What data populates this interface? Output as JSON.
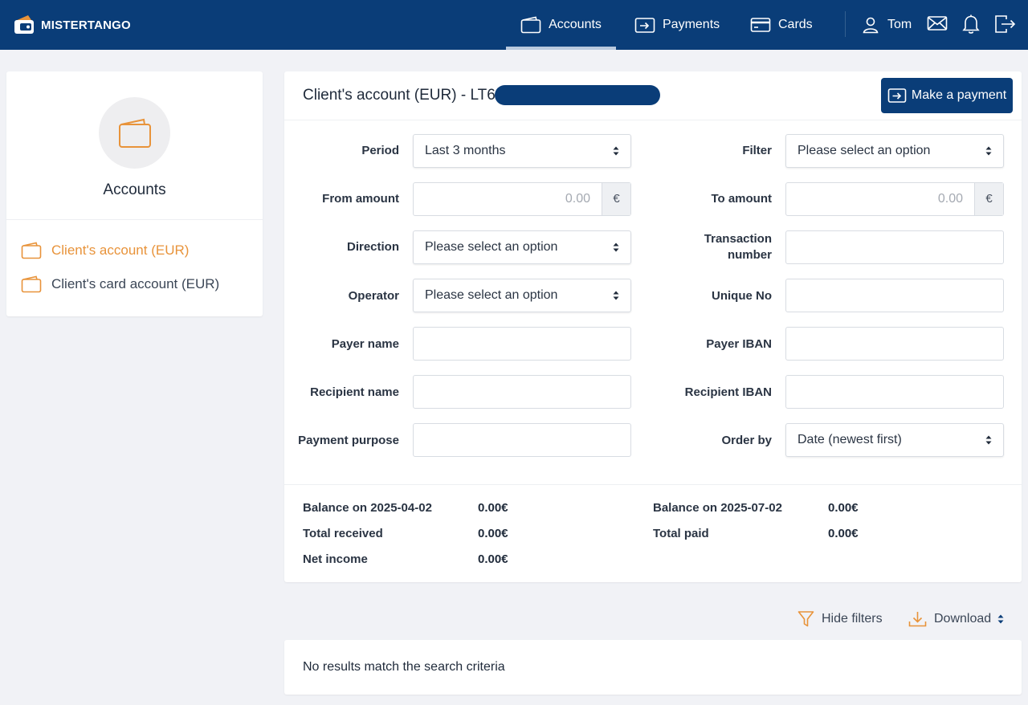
{
  "brand": {
    "name": "MISTERTANGO"
  },
  "nav": {
    "accounts": "Accounts",
    "payments": "Payments",
    "cards": "Cards",
    "user": "Tom"
  },
  "sidebar": {
    "title": "Accounts",
    "items": [
      {
        "label": "Client's account (EUR)",
        "active": true
      },
      {
        "label": "Client's card account (EUR)",
        "active": false
      }
    ]
  },
  "panel": {
    "title": "Client's account (EUR) - LT61",
    "make_payment": "Make a payment"
  },
  "filters": {
    "period": {
      "label": "Period",
      "value": "Last 3 months"
    },
    "filter": {
      "label": "Filter",
      "value": "Please select an option"
    },
    "from_amount": {
      "label": "From amount",
      "value": "0.00",
      "currency": "€"
    },
    "to_amount": {
      "label": "To amount",
      "value": "0.00",
      "currency": "€"
    },
    "direction": {
      "label": "Direction",
      "value": "Please select an option"
    },
    "transaction_number": {
      "label_line1": "Transaction",
      "label_line2": "number",
      "value": ""
    },
    "operator": {
      "label": "Operator",
      "value": "Please select an option"
    },
    "unique_no": {
      "label": "Unique No",
      "value": ""
    },
    "payer_name": {
      "label": "Payer name",
      "value": ""
    },
    "payer_iban": {
      "label": "Payer IBAN",
      "value": ""
    },
    "recipient_name": {
      "label": "Recipient name",
      "value": ""
    },
    "recipient_iban": {
      "label": "Recipient IBAN",
      "value": ""
    },
    "payment_purpose": {
      "label": "Payment purpose",
      "value": ""
    },
    "order_by": {
      "label": "Order by",
      "value": "Date (newest first)"
    }
  },
  "balances": {
    "opening": {
      "label": "Balance on 2025-04-02",
      "value": "0.00€"
    },
    "closing": {
      "label": "Balance on 2025-07-02",
      "value": "0.00€"
    },
    "received": {
      "label": "Total received",
      "value": "0.00€"
    },
    "paid": {
      "label": "Total paid",
      "value": "0.00€"
    },
    "net": {
      "label": "Net income",
      "value": "0.00€"
    }
  },
  "actions": {
    "hide_filters": "Hide filters",
    "download": "Download"
  },
  "results": {
    "empty_message": "No results match the search criteria"
  },
  "colors": {
    "brand": "#0a3d78",
    "accent": "#e8933a",
    "background": "#f1f2f6"
  }
}
